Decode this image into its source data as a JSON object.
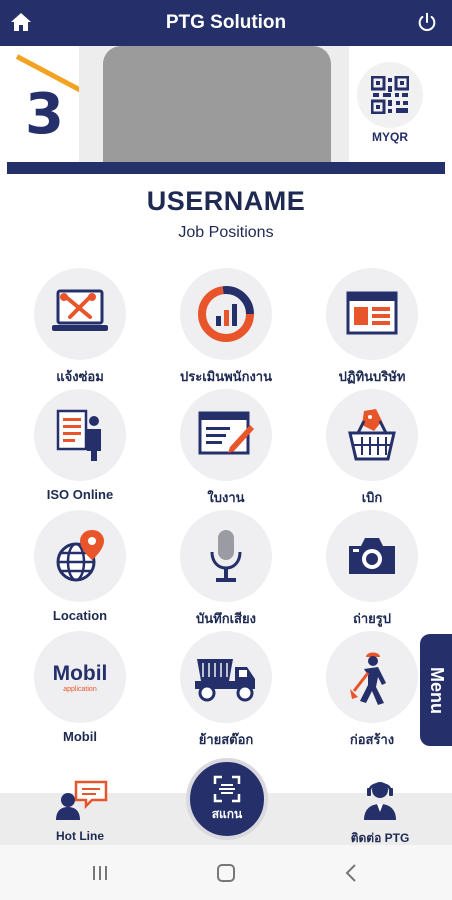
{
  "app": {
    "title": "PTG Solution"
  },
  "profile": {
    "number": "3",
    "qr_label": "MYQR",
    "username": "USERNAME",
    "job_positions": "Job Positions"
  },
  "grid": [
    {
      "label": "แจ้งซ่อม",
      "icon": "repair-laptop-icon"
    },
    {
      "label": "ประเมินพนักงาน",
      "icon": "evaluation-chart-icon"
    },
    {
      "label": "ปฏิทินบริษัท",
      "icon": "calendar-icon"
    },
    {
      "label": "ISO Online",
      "icon": "iso-document-icon"
    },
    {
      "label": "ใบงาน",
      "icon": "work-order-icon"
    },
    {
      "label": "เบิก",
      "icon": "requisition-basket-icon"
    },
    {
      "label": "Location",
      "icon": "location-globe-icon"
    },
    {
      "label": "บันทึกเสียง",
      "icon": "microphone-icon"
    },
    {
      "label": "ถ่ายรูป",
      "icon": "camera-icon"
    },
    {
      "label": "Mobil",
      "icon": "mobil-logo"
    },
    {
      "label": "ย้ายสต๊อก",
      "icon": "dump-truck-icon"
    },
    {
      "label": "ก่อสร้าง",
      "icon": "construction-worker-icon"
    }
  ],
  "mobil_logo_text": "Mobil",
  "mobil_logo_sub": "application",
  "menu_tab": "Menu",
  "bottom_nav": {
    "hotline": "Hot Line",
    "scan": "สแกน",
    "contact": "ติดต่อ PTG"
  },
  "colors": {
    "primary": "#25306b",
    "accent_orange": "#e8552b",
    "accent_yellow": "#f2a321"
  }
}
